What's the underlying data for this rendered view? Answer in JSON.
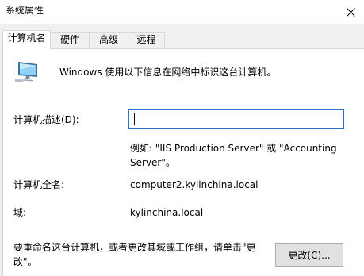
{
  "window": {
    "title": "系统属性"
  },
  "tabs": [
    {
      "label": "计算机名",
      "active": true
    },
    {
      "label": "硬件",
      "active": false
    },
    {
      "label": "高级",
      "active": false
    },
    {
      "label": "远程",
      "active": false
    }
  ],
  "computer_name_tab": {
    "intro": "Windows 使用以下信息在网络中标识这台计算机。",
    "description_label": "计算机描述(D):",
    "description_value": "",
    "example_text": "例如: \"IIS Production Server\" 或 \"Accounting Server\"。",
    "full_name_label": "计算机全名:",
    "full_name_value": "computer2.kylinchina.local",
    "domain_label": "域:",
    "domain_value": "kylinchina.local",
    "rename_text": "要重命名这台计算机，或者更改其域或工作组，请单击\"更改\"。",
    "change_button": "更改(C)..."
  },
  "icons": {
    "close": "close-icon",
    "computer": "computer-icon"
  },
  "colors": {
    "window_bg": "#f0f0f0",
    "panel_bg": "#ffffff",
    "focus_border": "#2877cf",
    "button_bg": "#e1e1e1"
  }
}
